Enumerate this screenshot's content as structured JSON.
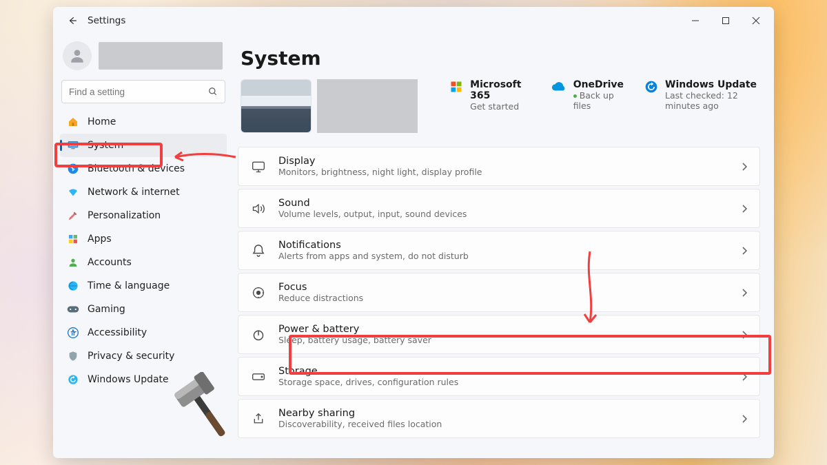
{
  "titlebar": {
    "title": "Settings"
  },
  "search": {
    "placeholder": "Find a setting"
  },
  "page_title": "System",
  "sidebar": {
    "items": [
      {
        "label": "Home"
      },
      {
        "label": "System"
      },
      {
        "label": "Bluetooth & devices"
      },
      {
        "label": "Network & internet"
      },
      {
        "label": "Personalization"
      },
      {
        "label": "Apps"
      },
      {
        "label": "Accounts"
      },
      {
        "label": "Time & language"
      },
      {
        "label": "Gaming"
      },
      {
        "label": "Accessibility"
      },
      {
        "label": "Privacy & security"
      },
      {
        "label": "Windows Update"
      }
    ]
  },
  "topcards": {
    "ms365": {
      "title": "Microsoft 365",
      "subtitle": "Get started"
    },
    "onedrive": {
      "title": "OneDrive",
      "subtitle": "Back up files"
    },
    "winupdate": {
      "title": "Windows Update",
      "subtitle": "Last checked: 12 minutes ago"
    }
  },
  "rows": [
    {
      "title": "Display",
      "subtitle": "Monitors, brightness, night light, display profile"
    },
    {
      "title": "Sound",
      "subtitle": "Volume levels, output, input, sound devices"
    },
    {
      "title": "Notifications",
      "subtitle": "Alerts from apps and system, do not disturb"
    },
    {
      "title": "Focus",
      "subtitle": "Reduce distractions"
    },
    {
      "title": "Power & battery",
      "subtitle": "Sleep, battery usage, battery saver"
    },
    {
      "title": "Storage",
      "subtitle": "Storage space, drives, configuration rules"
    },
    {
      "title": "Nearby sharing",
      "subtitle": "Discoverability, received files location"
    }
  ]
}
